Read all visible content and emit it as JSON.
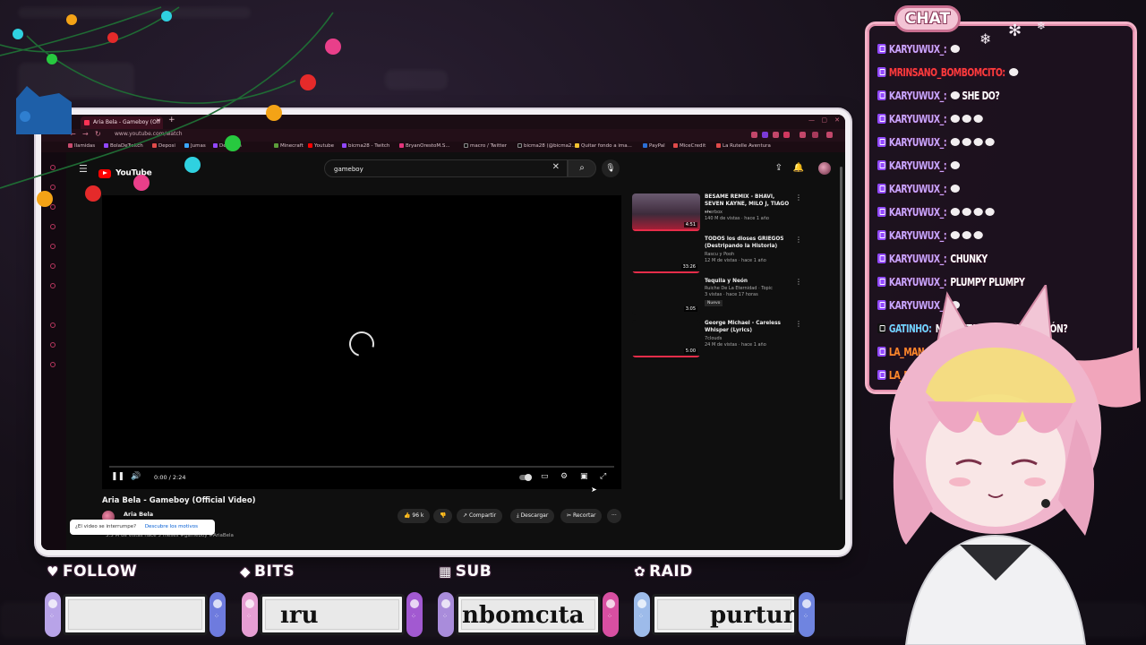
{
  "browser": {
    "tab_title": "Aria Bela - Gameboy (Off",
    "url": "www.youtube.com/watch",
    "bookmarks": [
      "Ilamidas",
      "BolaDeTwitch",
      "Deposi",
      "Jumas",
      "DeTwitch",
      "Minecraft",
      "Youtube",
      "bicma28 - Twitch",
      "BryanOrestoM.S...",
      "macro / Twitter",
      "bicma28 (@bicma2...",
      "Quitar fondo a ima...",
      "PayPal",
      "MiceCredit",
      "La Rutelle Aventura"
    ]
  },
  "youtube": {
    "logo_text": "YouTube",
    "search": {
      "value": "gameboy",
      "placeholder": "Buscar"
    },
    "player": {
      "time": "0:00 / 2:24"
    },
    "video": {
      "title": "Aria Bela - Gameboy (Official Video)",
      "channel": "Aria Bela",
      "likes": "96 k",
      "share": "Compartir",
      "download": "Descargar",
      "clip": "Recortar",
      "description": "3.5 M de vistas  hace 5 meses  #gameboy #AriaBela"
    },
    "tooltip": {
      "question": "¿El video se interrumpe?",
      "link": "Descubre los motivos"
    },
    "recommendations": [
      {
        "title": "BESAME REMIX - BHAVI, SEVEN KAYNE, MILO J, TIAGO ...",
        "channel": "sherbox",
        "meta": "140 M de vistas · hace 1 año",
        "duration": "4:51",
        "progress": 1.0
      },
      {
        "title": "TODOS los dioses GRIEGOS (Destripando la Historia)",
        "channel": "Rascu y Pooh",
        "meta": "12 M de vistas · hace 1 año",
        "duration": "33:26",
        "progress": 1.0
      },
      {
        "title": "Tequila y Neón",
        "channel": "Ruiche De La Eternidad · Topic",
        "meta": "3 vistas · hace 17 horas",
        "badge": "Nuevo",
        "duration": "3:05",
        "progress": 1.0
      },
      {
        "title": "George Michael - Careless Whisper (Lyrics)",
        "channel": "7clouds",
        "meta": "24 M de vistas · hace 1 año",
        "duration": "5:00",
        "progress": 1.0
      }
    ]
  },
  "chat": {
    "label": "CHAT",
    "messages": [
      {
        "platform": "twitch",
        "user": "KARYUWUX_:",
        "text": "",
        "user_color": "#c9a6ff",
        "emotes": 1
      },
      {
        "platform": "twitch",
        "user": "MRINSANO_BOMBOMCITO:",
        "text": "",
        "user_color": "#ff3b3b",
        "emotes": 1
      },
      {
        "platform": "twitch",
        "user": "KARYUWUX_:",
        "text": "SHE DO?",
        "user_color": "#c9a6ff",
        "emotes": 1
      },
      {
        "platform": "twitch",
        "user": "KARYUWUX_:",
        "text": "",
        "user_color": "#c9a6ff",
        "emotes": 3
      },
      {
        "platform": "twitch",
        "user": "KARYUWUX_:",
        "text": "",
        "user_color": "#c9a6ff",
        "emotes": 4
      },
      {
        "platform": "twitch",
        "user": "KARYUWUX_:",
        "text": "",
        "user_color": "#c9a6ff",
        "emotes": 1
      },
      {
        "platform": "twitch",
        "user": "KARYUWUX_:",
        "text": "",
        "user_color": "#c9a6ff",
        "emotes": 1
      },
      {
        "platform": "twitch",
        "user": "KARYUWUX_:",
        "text": "",
        "user_color": "#c9a6ff",
        "emotes": 4
      },
      {
        "platform": "twitch",
        "user": "KARYUWUX_:",
        "text": "",
        "user_color": "#c9a6ff",
        "emotes": 3
      },
      {
        "platform": "twitch",
        "user": "KARYUWUX_:",
        "text": "CHUNKY",
        "user_color": "#c9a6ff",
        "emotes": 0
      },
      {
        "platform": "twitch",
        "user": "KARYUWUX_:",
        "text": "PLUMPY PLUMPY",
        "user_color": "#c9a6ff",
        "emotes": 0
      },
      {
        "platform": "twitch",
        "user": "KARYUWUX_:",
        "text": "",
        "user_color": "#c9a6ff",
        "emotes": 1
      },
      {
        "platform": "tiktok",
        "user": "GATINHO:",
        "text": "NECESITA PA... UNA CANCIÓN?",
        "user_color": "#6fd3ff",
        "emotes": 0
      },
      {
        "platform": "twitch",
        "user": "LA_MAN",
        "text": "",
        "user_color": "#ff8a2a",
        "emotes": 0
      },
      {
        "platform": "twitch",
        "user": "LA_M",
        "text": "",
        "user_color": "#ff8a2a",
        "emotes": 0
      }
    ]
  },
  "alerts": [
    {
      "label": "FOLLOW",
      "icon": "heart-icon",
      "value": ""
    },
    {
      "label": "BITS",
      "icon": "gem-icon",
      "value": "ıru"
    },
    {
      "label": "SUB",
      "icon": "gift-icon",
      "value": "nbomcıta"
    },
    {
      "label": "RAID",
      "icon": "paw-icon",
      "value": "purtury"
    }
  ],
  "colors": {
    "accent_pink": "#f4b2c8",
    "youtube_red": "#ff0000",
    "chat_user": "#c9a6ff",
    "chat_alt_user": "#ff3b3b"
  }
}
